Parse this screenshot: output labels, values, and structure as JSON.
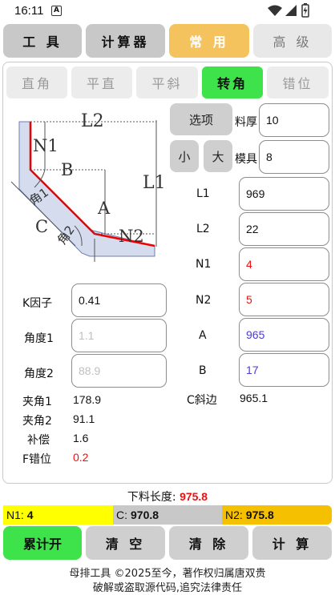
{
  "status_bar": {
    "time": "16:11",
    "app_icon": "A"
  },
  "top_tabs": [
    {
      "label": "工 具",
      "state": "normal"
    },
    {
      "label": "计算器",
      "state": "normal"
    },
    {
      "label": "常 用",
      "state": "active"
    },
    {
      "label": "高 级",
      "state": "muted"
    }
  ],
  "sub_tabs": [
    {
      "label": "直角"
    },
    {
      "label": "平直"
    },
    {
      "label": "平斜"
    },
    {
      "label": "转角"
    },
    {
      "label": "错位"
    }
  ],
  "diagram_labels": {
    "l2": "L2",
    "n1": "N1",
    "b": "B",
    "l1": "L1",
    "a": "A",
    "c": "C",
    "angle1": "角1",
    "angle2": "角2",
    "n2": "N2"
  },
  "options": {
    "options_button": "选项",
    "small_button": "小",
    "large_button": "大",
    "thickness_label": "料厚",
    "thickness_value": "10",
    "die_label": "模具",
    "die_value": "8"
  },
  "right_fields": [
    {
      "label": "L1",
      "value": "969",
      "color": "default"
    },
    {
      "label": "L2",
      "value": "22",
      "color": "default"
    },
    {
      "label": "N1",
      "value": "4",
      "color": "red"
    },
    {
      "label": "N2",
      "value": "5",
      "color": "red"
    },
    {
      "label": "A",
      "value": "965",
      "color": "blue"
    },
    {
      "label": "B",
      "value": "17",
      "color": "blue"
    }
  ],
  "left_fields": [
    {
      "label": "K因子",
      "value": "0.41",
      "placeholder": ""
    },
    {
      "label": "角度1",
      "value": "",
      "placeholder": "1.1"
    },
    {
      "label": "角度2",
      "value": "",
      "placeholder": "88.9"
    }
  ],
  "results": {
    "jiajiao1_label": "夹角1",
    "jiajiao1_value": "178.9",
    "c_side_label": "C斜边",
    "c_side_value": "965.1",
    "jiajiao2_label": "夹角2",
    "jiajiao2_value": "91.1",
    "compensation_label": "补偿",
    "compensation_value": "1.6",
    "f_offset_label": "F错位",
    "f_offset_value": "0.2"
  },
  "blank_length": {
    "label": "下料长度:",
    "value": "975.8"
  },
  "summary_bar": {
    "n1_label": "N1:",
    "n1_value": "4",
    "c_label": "C:",
    "c_value": "970.8",
    "n2_label": "N2:",
    "n2_value": "975.8"
  },
  "bottom_buttons": {
    "accumulate": "累计开",
    "clear_all": "清 空",
    "clear": "清 除",
    "calculate": "计 算"
  },
  "footer": {
    "line1": "母排工具 ©2025至今，著作权归属唐双贵",
    "line2": "破解或盗取源代码,追究法律责任"
  },
  "colors": {
    "accent_orange": "#f5c35d",
    "active_green": "#3ee24a",
    "yellow": "#ffff00",
    "gold": "#f5c000",
    "red_value": "#e11111",
    "blue_value": "#4b3bd0"
  }
}
